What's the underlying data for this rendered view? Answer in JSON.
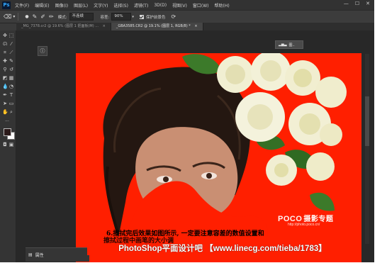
{
  "app": {
    "logo": "Ps",
    "menu": [
      "文件(F)",
      "编辑(E)",
      "图像(I)",
      "图层(L)",
      "文字(Y)",
      "选择(S)",
      "滤镜(T)",
      "3D(D)",
      "视图(V)",
      "窗口(W)",
      "帮助(H)"
    ]
  },
  "options": {
    "mode_label": "模式:",
    "mode_value": "不连续",
    "tolerance_label": "容差:",
    "tolerance_value": "90%",
    "protect_label": "保护前景色"
  },
  "tabs": [
    {
      "label": "_MG_7378.cr2 @ 19.6% (图层 1 把面板(M) ...",
      "close": "×"
    },
    {
      "label": "_GBA3585.CR2 @ 19.1% (图层 1, RGB/8) *",
      "close": "×"
    }
  ],
  "panel": {
    "layer_flyout": "图..",
    "properties_label": "属性"
  },
  "caption": {
    "line1": "6.擦拭完后效果如图所示, 一定要注意容差的数值设置和",
    "line2": "擦拭过程中画笔的大小调",
    "banner": "PhotoShop平面设计吧 【www.linecg.com/tieba/1783】"
  },
  "watermark": {
    "brand": "POCO",
    "brand_cn": "摄影专题",
    "url": "http://photo.poco.cn/"
  },
  "colors": {
    "canvas_background": "#ff1f00",
    "foreground_swatch": "#2b1a1a",
    "background_swatch": "#ffffff"
  }
}
